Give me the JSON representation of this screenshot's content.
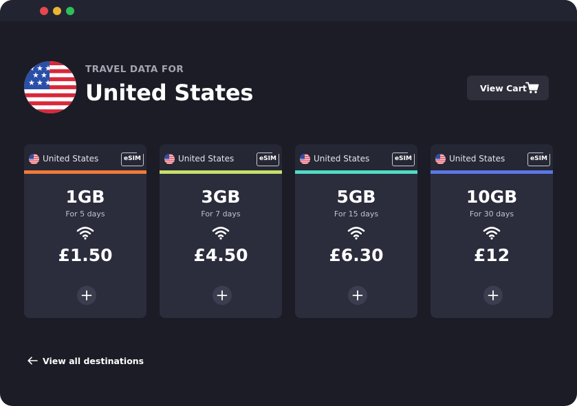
{
  "window": {
    "controls": [
      "close",
      "minimize",
      "maximize"
    ],
    "colors": {
      "close": "#e5484d",
      "minimize": "#e8b730",
      "maximize": "#2fbf57"
    }
  },
  "header": {
    "flag_icon": "us-flag-icon",
    "subtitle": "TRAVEL DATA FOR",
    "title": "United States",
    "cart_button": {
      "label": "View Cart",
      "icon": "shopping-cart-icon"
    }
  },
  "plans": [
    {
      "country": "United States",
      "badge": "eSIM",
      "data": "1GB",
      "duration": "For 5 days",
      "price": "£1.50",
      "accent": "#f07a3a"
    },
    {
      "country": "United States",
      "badge": "eSIM",
      "data": "3GB",
      "duration": "For 7 days",
      "price": "£4.50",
      "accent": "#c6e06a"
    },
    {
      "country": "United States",
      "badge": "eSIM",
      "data": "5GB",
      "duration": "For 15 days",
      "price": "£6.30",
      "accent": "#4fdcc4"
    },
    {
      "country": "United States",
      "badge": "eSIM",
      "data": "10GB",
      "duration": "For 30 days",
      "price": "£12",
      "accent": "#5b76e6"
    }
  ],
  "footer": {
    "back_link": "View all destinations",
    "icon": "arrow-left-icon"
  }
}
